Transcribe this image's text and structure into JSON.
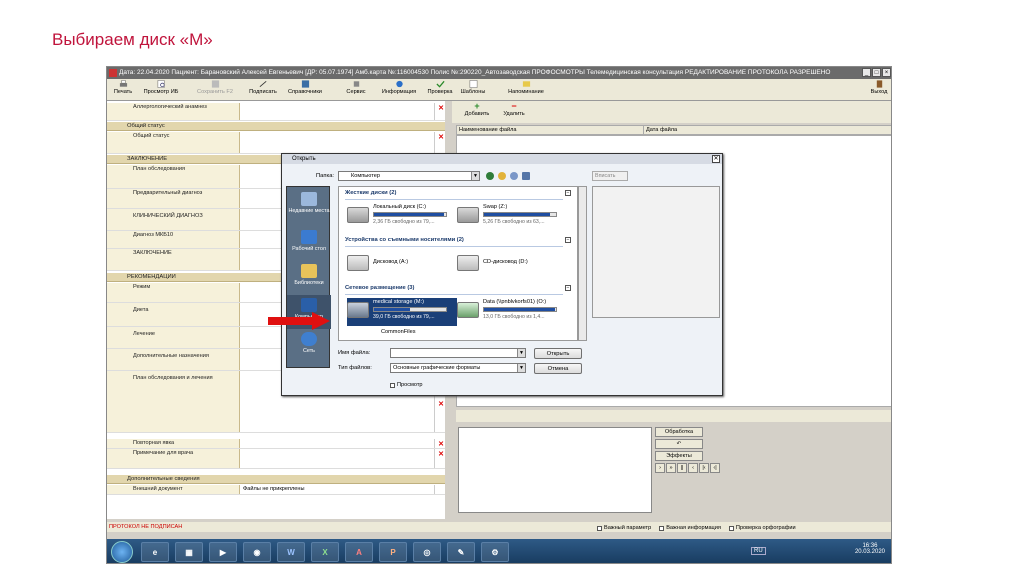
{
  "slide": {
    "title": "Выбираем диск «М»"
  },
  "window": {
    "title": "Дата: 22.04.2020 Пациент: Барановский Алексей Евгеньевич   [ДР: 05.07.1974]  Амб.карта №:116004530  Полис №:290220_Автозаводская ПРОФОСМОТРЫ Телемедицинская консультация РЕДАКТИРОВАНИЕ ПРОТОКОЛА РАЗРЕШЕНО",
    "controls": [
      "_",
      "□",
      "×"
    ]
  },
  "toolbar": {
    "print": "Печать",
    "preview": "Просмотр ИБ",
    "save": "Сохранить F2",
    "sign": "Подписать",
    "references": "Справочники",
    "service": "Сервис",
    "info": "Информация",
    "check": "Проверка",
    "templates": "Шаблоны",
    "reminders": "Напоминание",
    "exit": "Выход"
  },
  "form": {
    "rows": [
      {
        "label": "Аллергологический анамнез"
      },
      {
        "label": "Общий статус"
      },
      {
        "label": "План обследования"
      },
      {
        "label": "Предварительный диагноз"
      },
      {
        "label": "КЛИНИЧЕСКИЙ ДИАГНОЗ"
      },
      {
        "label": "Диагноз МКБ10"
      },
      {
        "label": "ЗАКЛЮЧЕНИЕ"
      },
      {
        "label": "Режим"
      },
      {
        "label": "Диета"
      },
      {
        "label": "Лечение"
      },
      {
        "label": "Дополнительные назначения"
      },
      {
        "label": "План обследования и лечения"
      },
      {
        "label": "Повторная явка"
      },
      {
        "label": "Примечание для врача"
      },
      {
        "label": "Внешний документ",
        "value": "Файлы не прикреплены"
      }
    ],
    "sections": [
      "Общий статус",
      "ЗАКЛЮЧЕНИЕ",
      "РЕКОМЕНДАЦИИ",
      "Дополнительные сведения"
    ]
  },
  "files": {
    "add": "Добавить",
    "remove": "Удалить",
    "col_name": "Наименование файла",
    "col_date": "Дата файла"
  },
  "media": {
    "processing": "Обработка",
    "effects": "Эффекты",
    "transport": [
      "›",
      "»",
      "||",
      "‹",
      "|‹",
      "‹|"
    ]
  },
  "status": {
    "unsigned": "ПРОТОКОЛ НЕ ПОДПИСАН",
    "checks": [
      "Важный параметр",
      "Важная информация",
      "Проверка орфографии"
    ]
  },
  "dialog": {
    "title": "Открыть",
    "folder_label": "Папка:",
    "folder_value": "Компьютер",
    "view_value": "Вписать",
    "places": [
      "Недавние места",
      "Рабочий стол",
      "Библиотеки",
      "Компьютер",
      "Сеть"
    ],
    "groups": [
      "Жесткие диски (2)",
      "Устройства со съемными носителями (2)",
      "Сетевое размещение (3)"
    ],
    "drives": [
      {
        "name": "Локальный диск (C:)",
        "free": "2,36 ГБ свободно из 79,...",
        "fill": 0.97
      },
      {
        "name": "Swap (Z:)",
        "free": "5,26 ГБ свободно из 63,...",
        "fill": 0.92
      },
      {
        "name": "Дисковод (A:)"
      },
      {
        "name": "CD-дисковод (D:)"
      },
      {
        "name": "medical storage (M:)",
        "free": "39,0 ГБ свободно из 79,...",
        "fill": 0.5
      },
      {
        "name": "Data (\\\\pnblvkorfs01) (O:)",
        "free": "13,0 ГБ свободно из 1,4...",
        "fill": 0.99
      },
      {
        "name": "CommonFiles"
      }
    ],
    "filename_label": "Имя файла:",
    "filetype_label": "Тип файлов:",
    "filetype_value": "Основные графические форматы",
    "open_button": "Открыть",
    "cancel_button": "Отмена",
    "preview_checkbox": "Просмотр"
  },
  "taskbar": {
    "apps": [
      "e",
      "▦",
      "▶",
      "◉",
      "W",
      "X",
      "A",
      "P",
      "◎",
      "✎",
      "⚙"
    ],
    "lang": "RU",
    "time": "16:36",
    "date": "20.03.2020"
  },
  "colors": {
    "accent": "#1a3f78",
    "title_red": "#c0143c",
    "arrow_red": "#e01010"
  }
}
